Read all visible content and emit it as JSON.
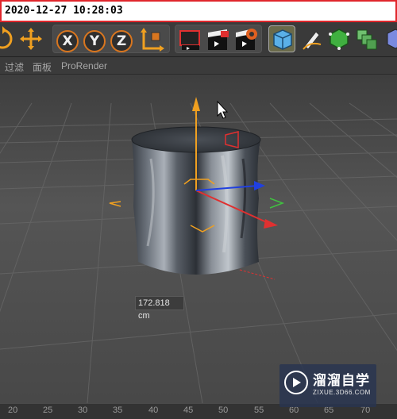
{
  "timestamp": "2020-12-27  10:28:03",
  "toolbar": {
    "icons": [
      "rotate-icon",
      "move-icon",
      "x-axis-lock",
      "y-axis-lock",
      "z-axis-lock",
      "coordinate-system-icon",
      "render-view-icon",
      "render-picture-viewer-icon",
      "render-settings-icon",
      "cube-icon",
      "pen-icon",
      "subdivision-icon",
      "array-icon",
      "deformer-icon"
    ],
    "axis_x": "X",
    "axis_y": "Y",
    "axis_z": "Z"
  },
  "menu": {
    "filter": "过滤",
    "panel": "面板",
    "prorender": "ProRender"
  },
  "viewport": {
    "object": "cylinder",
    "dimension_label": "172.818 cm"
  },
  "ruler": {
    "ticks": [
      "20",
      "25",
      "30",
      "35",
      "40",
      "45",
      "50",
      "55",
      "60",
      "65",
      "70"
    ]
  },
  "watermark": {
    "title": "溜溜自学",
    "subtitle": "ZIXUE.3D66.COM"
  },
  "colors": {
    "axis_y": "#f0a020",
    "axis_x": "#e03030",
    "axis_z": "#2040e0",
    "axis_green": "#40c040",
    "timestamp_border": "#e0262b"
  }
}
